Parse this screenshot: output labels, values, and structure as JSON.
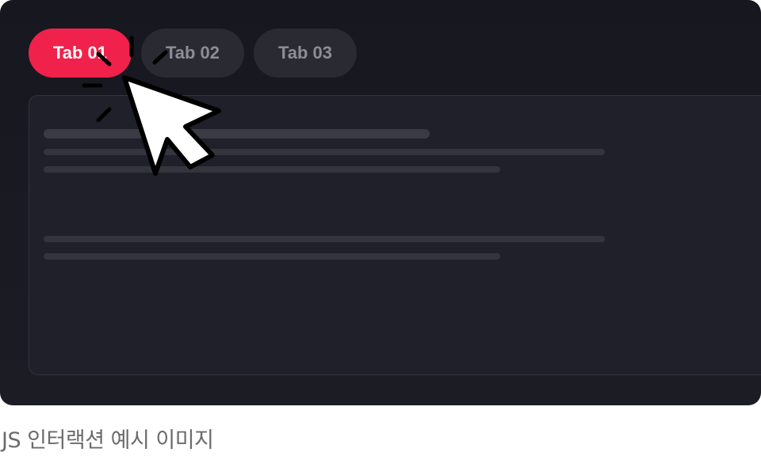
{
  "tabs": [
    {
      "label": "Tab 01",
      "active": true
    },
    {
      "label": "Tab 02",
      "active": false
    },
    {
      "label": "Tab 03",
      "active": false
    }
  ],
  "caption": "JS 인터랙션 예시 이미지",
  "colors": {
    "active_tab": "#f0214b",
    "inactive_tab": "#2a2a32",
    "background": "#17171f",
    "panel": "#20202a"
  },
  "icons": {
    "cursor": "mouse-pointer-icon",
    "click_burst": "click-burst-icon"
  }
}
